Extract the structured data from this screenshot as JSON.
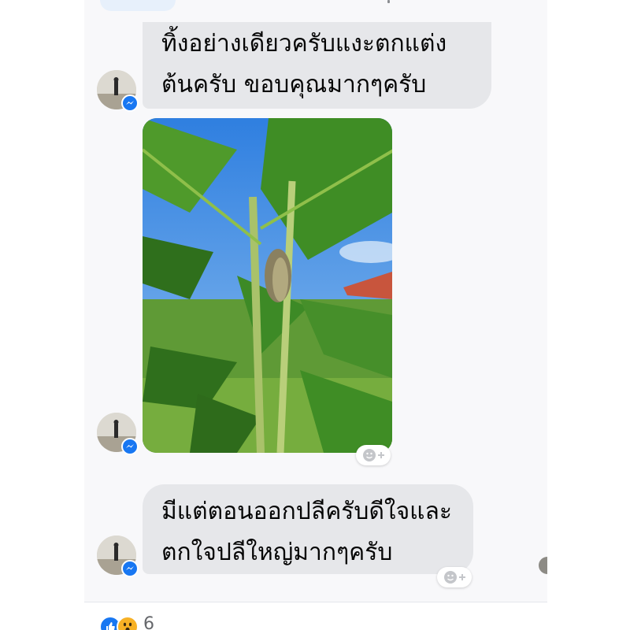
{
  "conversation": {
    "messages": [
      {
        "type": "text",
        "lines": [
          "ทิ้งอย่างเดียวครับแงะตกแต่ง",
          "ต้นครับ ขอบคุณมากๆครับ"
        ]
      },
      {
        "type": "image",
        "description": "banana-plant-photo"
      },
      {
        "type": "text",
        "lines": [
          "มีแต่ตอนออกปลีครับดีใจและ",
          "ตกใจปลีใหญ่มากๆครับ"
        ]
      }
    ]
  },
  "footer": {
    "reaction_count": "6",
    "reactions": [
      "like",
      "wow"
    ]
  },
  "icons": {
    "avatar": "profile-avatar",
    "badge": "messenger-icon",
    "react": "add-reaction-icon"
  },
  "colors": {
    "bubble": "#e6e7ea",
    "messenger_blue": "#1877f2",
    "wow_yellow": "#f7b125",
    "text": "#050505"
  }
}
